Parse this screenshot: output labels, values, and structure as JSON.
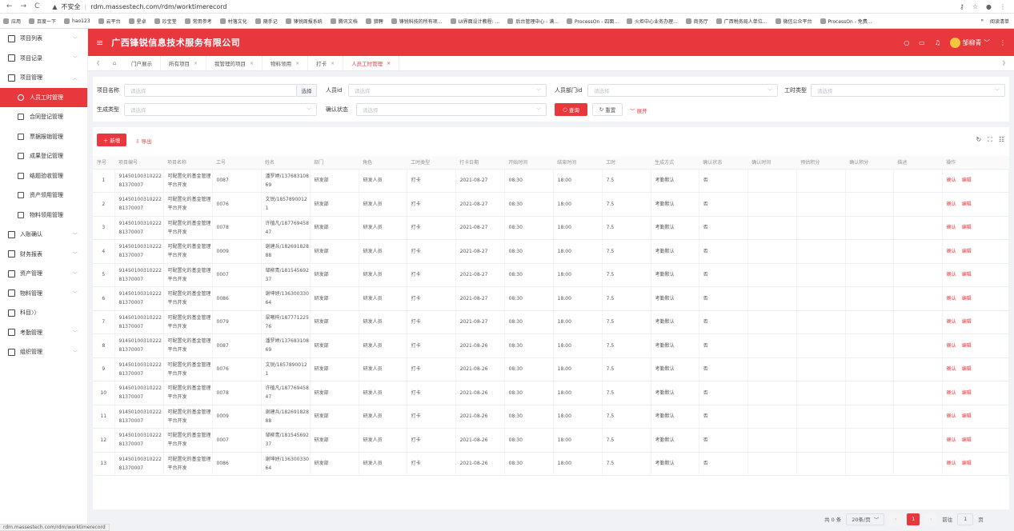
{
  "browser": {
    "security_label": "不安全",
    "url": "rdm.massestech.com/rdm/worktimerecord",
    "status_url": "rdm.massestech.com/rdm/worktimerecord",
    "bookmarks": [
      "应用",
      "百度一下",
      "hao123",
      "云平台",
      "星卓",
      "珍宝堂",
      "常用参考",
      "村落文化",
      "随手记",
      "锋锐周报系统",
      "腾讯文档",
      "猎聘",
      "锋锐科技的所有项...",
      "UI界面设计教程: ...",
      "后台管理中心 - 满...",
      "ProcessOn - 四面...",
      "火炬中心业务办理...",
      "商务厅",
      "广西税务局人单位...",
      "微信公众平台",
      "ProcessOn - 免费..."
    ],
    "reading_list": "阅读清单"
  },
  "sidebar": {
    "items": [
      {
        "label": "项目列表",
        "type": "group",
        "chev": "﹀"
      },
      {
        "label": "项目记录",
        "type": "group",
        "chev": "﹀"
      },
      {
        "label": "项目管理",
        "type": "group",
        "chev": "︿"
      },
      {
        "label": "人员工时管理",
        "type": "sub",
        "active": true
      },
      {
        "label": "合同登记管理",
        "type": "sub"
      },
      {
        "label": "票据报销管理",
        "type": "sub"
      },
      {
        "label": "成果登记管理",
        "type": "sub"
      },
      {
        "label": "结题验收管理",
        "type": "sub"
      },
      {
        "label": "资产领用管理",
        "type": "sub"
      },
      {
        "label": "物料领用管理",
        "type": "sub"
      },
      {
        "label": "入账确认",
        "type": "group",
        "chev": "﹀"
      },
      {
        "label": "财务报表",
        "type": "group",
        "chev": "﹀"
      },
      {
        "label": "资产管理",
        "type": "group",
        "chev": "﹀"
      },
      {
        "label": "物料管理",
        "type": "group",
        "chev": "﹀"
      },
      {
        "label": "科目〉〉",
        "type": "group",
        "chev": ""
      },
      {
        "label": "考勤管理",
        "type": "group",
        "chev": "﹀"
      },
      {
        "label": "组织管理",
        "type": "group",
        "chev": "﹀"
      }
    ]
  },
  "header": {
    "title": "广西锋锐信息技术服务有限公司",
    "user": "邹柳青"
  },
  "tabs": [
    {
      "label": "门户展示",
      "closable": false
    },
    {
      "label": "所有项目",
      "closable": true
    },
    {
      "label": "我管理的项目",
      "closable": true
    },
    {
      "label": "物料领用",
      "closable": true
    },
    {
      "label": "打卡",
      "closable": true
    },
    {
      "label": "人员工时管理",
      "closable": true,
      "active": true
    }
  ],
  "filter": {
    "project_name_label": "项目名称",
    "project_name_placeholder": "请选择",
    "select_button": "选择",
    "person_id_label": "人员id",
    "person_id_placeholder": "请选择",
    "dept_id_label": "人员部门id",
    "dept_id_placeholder": "请选择",
    "worktime_type_label": "工时类型",
    "worktime_type_placeholder": "请选择",
    "gen_type_label": "生成类型",
    "gen_type_placeholder": "请选择",
    "confirm_state_label": "确认状态",
    "confirm_state_placeholder": "请选择",
    "query_button": "查询",
    "reset_button": "重置",
    "expand_button": "展开"
  },
  "toolbar": {
    "add_button": "新增",
    "export_button": "导出"
  },
  "table": {
    "columns": [
      "序号",
      "项目编号",
      "项目名称",
      "工号",
      "姓名",
      "部门",
      "角色",
      "工时类型",
      "打卡日期",
      "开始时间",
      "结束时间",
      "工时",
      "生成方式",
      "确认状态",
      "确认时间",
      "预估积分",
      "确认积分",
      "描述",
      "操作"
    ],
    "op_confirm": "确认",
    "op_edit": "编辑",
    "rows": [
      {
        "seq": "1",
        "code": "9145010031022281370007",
        "pname": "可配置化的基金管理平台开发",
        "no": "0087",
        "name": "潘罗婷/13768310869",
        "dept": "研发部",
        "role": "研发人员",
        "wtype": "打卡",
        "date": "2021-08-27",
        "start": "08:30",
        "end": "18:00",
        "hours": "7.5",
        "gen": "考勤默认",
        "state": "否"
      },
      {
        "seq": "2",
        "code": "9145010031022281370007",
        "pname": "可配置化的基金管理平台开发",
        "no": "0076",
        "name": "文锐/18578900121",
        "dept": "研发部",
        "role": "研发人员",
        "wtype": "打卡",
        "date": "2021-08-27",
        "start": "08:30",
        "end": "18:00",
        "hours": "7.5",
        "gen": "考勤默认",
        "state": "否"
      },
      {
        "seq": "3",
        "code": "9145010031022281370007",
        "pname": "可配置化的基金管理平台开发",
        "no": "0078",
        "name": "许植凡/18776945847",
        "dept": "研发部",
        "role": "研发人员",
        "wtype": "打卡",
        "date": "2021-08-27",
        "start": "08:30",
        "end": "18:00",
        "hours": "7.5",
        "gen": "考勤默认",
        "state": "否"
      },
      {
        "seq": "4",
        "code": "9145010031022281370007",
        "pname": "可配置化的基金管理平台开发",
        "no": "0009",
        "name": "谢建兵/18269182888",
        "dept": "研发部",
        "role": "研发人员",
        "wtype": "打卡",
        "date": "2021-08-27",
        "start": "08:30",
        "end": "18:00",
        "hours": "7.5",
        "gen": "考勤默认",
        "state": "否"
      },
      {
        "seq": "5",
        "code": "9145010031022281370007",
        "pname": "可配置化的基金管理平台开发",
        "no": "0007",
        "name": "邹柳青/18154569237",
        "dept": "研发部",
        "role": "研发人员",
        "wtype": "打卡",
        "date": "2021-08-27",
        "start": "08:30",
        "end": "18:00",
        "hours": "7.5",
        "gen": "考勤默认",
        "state": "否"
      },
      {
        "seq": "6",
        "code": "9145010031022281370007",
        "pname": "可配置化的基金管理平台开发",
        "no": "0086",
        "name": "谢坤妤/13630033064",
        "dept": "研发部",
        "role": "研发人员",
        "wtype": "打卡",
        "date": "2021-08-27",
        "start": "08:30",
        "end": "18:00",
        "hours": "7.5",
        "gen": "考勤默认",
        "state": "否"
      },
      {
        "seq": "7",
        "code": "9145010031022281370007",
        "pname": "可配置化的基金管理平台开发",
        "no": "0079",
        "name": "梁曦梓/18777122576",
        "dept": "研发部",
        "role": "研发人员",
        "wtype": "打卡",
        "date": "2021-08-27",
        "start": "08:30",
        "end": "18:00",
        "hours": "7.5",
        "gen": "考勤默认",
        "state": "否"
      },
      {
        "seq": "8",
        "code": "9145010031022281370007",
        "pname": "可配置化的基金管理平台开发",
        "no": "0087",
        "name": "潘罗婷/13768310869",
        "dept": "研发部",
        "role": "研发人员",
        "wtype": "打卡",
        "date": "2021-08-26",
        "start": "08:30",
        "end": "18:00",
        "hours": "7.5",
        "gen": "考勤默认",
        "state": "否"
      },
      {
        "seq": "9",
        "code": "9145010031022281370007",
        "pname": "可配置化的基金管理平台开发",
        "no": "0076",
        "name": "文锐/18578900121",
        "dept": "研发部",
        "role": "研发人员",
        "wtype": "打卡",
        "date": "2021-08-26",
        "start": "08:30",
        "end": "18:00",
        "hours": "7.5",
        "gen": "考勤默认",
        "state": "否"
      },
      {
        "seq": "10",
        "code": "9145010031022281370007",
        "pname": "可配置化的基金管理平台开发",
        "no": "0078",
        "name": "许植凡/18776945847",
        "dept": "研发部",
        "role": "研发人员",
        "wtype": "打卡",
        "date": "2021-08-26",
        "start": "08:30",
        "end": "18:00",
        "hours": "7.5",
        "gen": "考勤默认",
        "state": "否"
      },
      {
        "seq": "11",
        "code": "9145010031022281370007",
        "pname": "可配置化的基金管理平台开发",
        "no": "0009",
        "name": "谢建兵/18269182888",
        "dept": "研发部",
        "role": "研发人员",
        "wtype": "打卡",
        "date": "2021-08-26",
        "start": "08:30",
        "end": "18:00",
        "hours": "7.5",
        "gen": "考勤默认",
        "state": "否"
      },
      {
        "seq": "12",
        "code": "9145010031022281370007",
        "pname": "可配置化的基金管理平台开发",
        "no": "0007",
        "name": "邹柳青/18154569237",
        "dept": "研发部",
        "role": "研发人员",
        "wtype": "打卡",
        "date": "2021-08-26",
        "start": "08:30",
        "end": "18:00",
        "hours": "7.5",
        "gen": "考勤默认",
        "state": "否"
      },
      {
        "seq": "13",
        "code": "9145010031022281370007",
        "pname": "可配置化的基金管理平台开发",
        "no": "0086",
        "name": "谢坤妤/13630033064",
        "dept": "研发部",
        "role": "研发人员",
        "wtype": "打卡",
        "date": "2021-08-26",
        "start": "08:30",
        "end": "18:00",
        "hours": "7.5",
        "gen": "考勤默认",
        "state": "否"
      }
    ]
  },
  "pagination": {
    "total": "共 0 条",
    "page_size": "20条/页",
    "current_page": "1",
    "goto_label": "前往",
    "goto_value": "1",
    "page_unit": "页"
  },
  "colors": {
    "accent": "#e8383d"
  }
}
